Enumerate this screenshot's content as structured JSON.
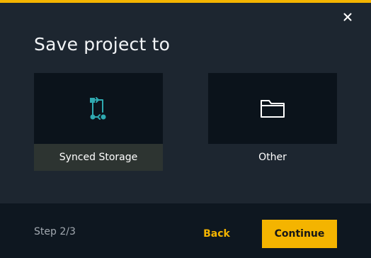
{
  "dialog": {
    "title": "Save project to",
    "close_icon": "close-icon"
  },
  "options": [
    {
      "label": "Synced Storage",
      "icon": "sync-icon",
      "selected": true
    },
    {
      "label": "Other",
      "icon": "folder-icon",
      "selected": false
    }
  ],
  "footer": {
    "step": "Step 2/3",
    "back_label": "Back",
    "continue_label": "Continue"
  },
  "colors": {
    "accent": "#f4b400",
    "icon_teal": "#2fa9b0",
    "background": "#1d2630",
    "footer_background": "#0e1720",
    "tile_background": "#0b131b",
    "selected_label_background": "#2d3431"
  }
}
